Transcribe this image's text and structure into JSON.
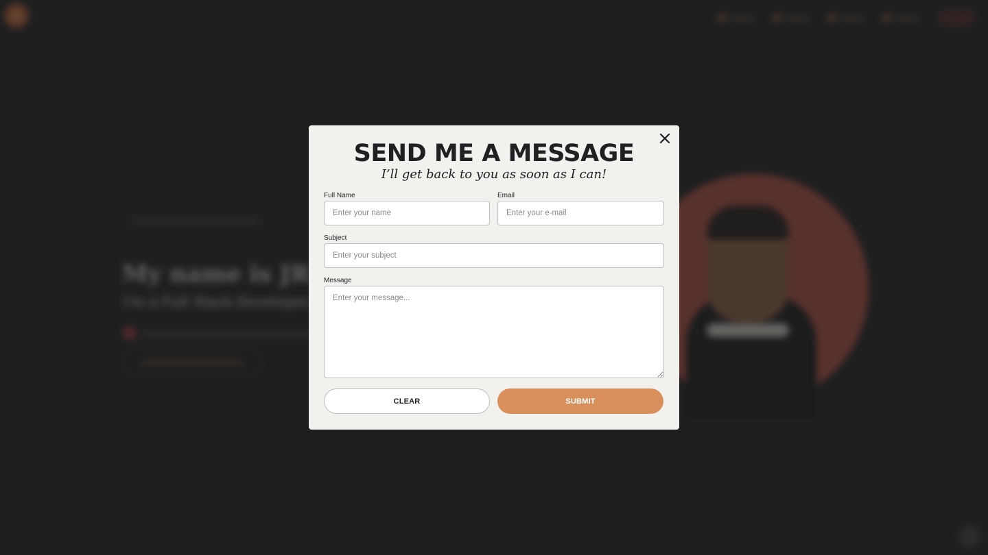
{
  "modal": {
    "title": "SEND ME A MESSAGE",
    "subtitle": "I’ll get back to you as soon as I can!",
    "close_icon": "close-icon"
  },
  "form": {
    "full_name": {
      "label": "Full Name",
      "placeholder": "Enter your name",
      "value": ""
    },
    "email": {
      "label": "Email",
      "placeholder": "Enter your e-mail",
      "value": ""
    },
    "subject": {
      "label": "Subject",
      "placeholder": "Enter your subject",
      "value": ""
    },
    "message": {
      "label": "Message",
      "placeholder": "Enter your message...",
      "value": ""
    },
    "clear_label": "CLEAR",
    "submit_label": "SUBMIT"
  },
  "background": {
    "hero_title": "My name is JR Rol",
    "hero_role": "I'm a Full Stack Developer"
  },
  "colors": {
    "page_background": "#252627",
    "modal_background": "#f3f1ee",
    "accent": "#d9905c",
    "avatar_circle": "#c75a4c",
    "text_dark": "#1f2022"
  }
}
